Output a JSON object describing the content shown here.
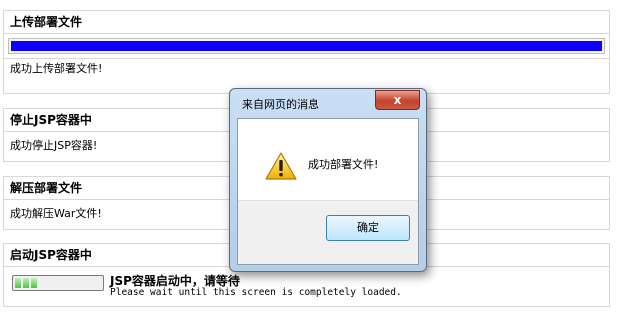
{
  "upload": {
    "header": "上传部署文件",
    "progress": 1.0,
    "status": "成功上传部署文件!"
  },
  "stop": {
    "header": "停止JSP容器中",
    "status": "成功停止JSP容器!"
  },
  "unzip": {
    "header": "解压部署文件",
    "status": "成功解压War文件!"
  },
  "start": {
    "header": "启动JSP容器中",
    "progress_segments": 3,
    "title": "JSP容器启动中，请等待",
    "subtitle": "Please wait until this screen is completely loaded."
  },
  "dialog": {
    "title": "来自网页的消息",
    "close_glyph": "x",
    "message": "成功部署文件!",
    "ok_label": "确定"
  },
  "colors": {
    "progress_fill": "#0e00ff",
    "mini_progress": "#4fc444"
  }
}
